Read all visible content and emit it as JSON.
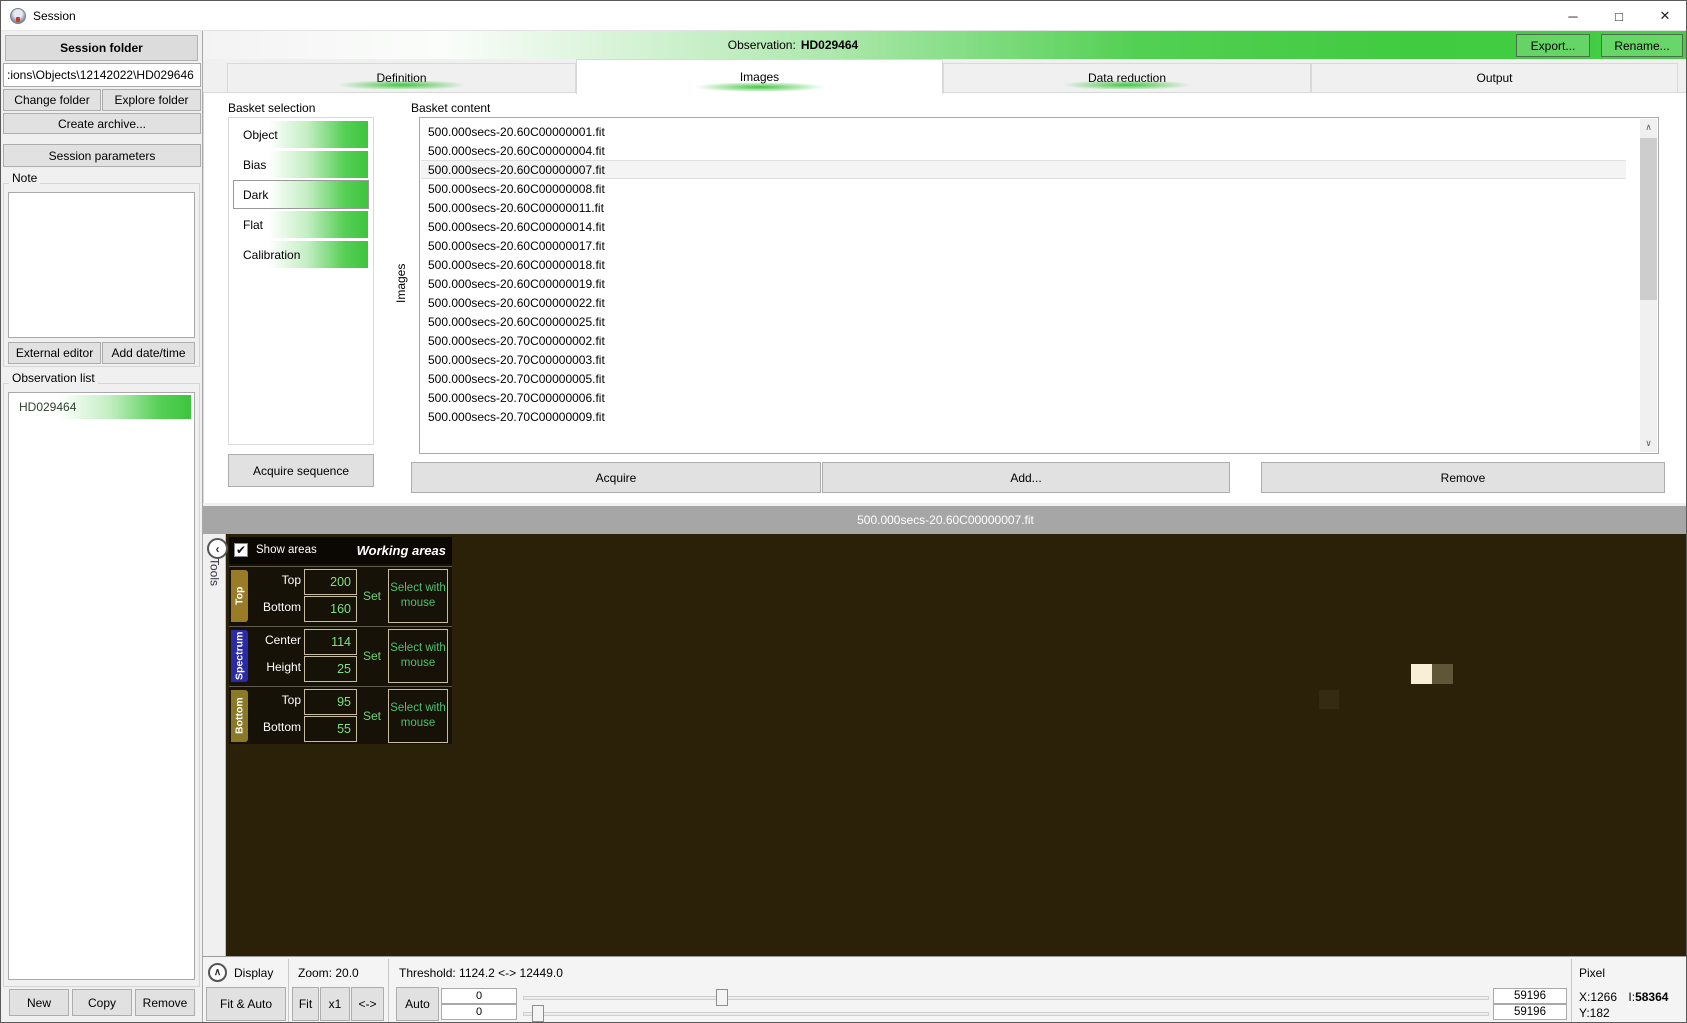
{
  "window": {
    "title": "Session",
    "minimize_glyph": "─",
    "maximize_glyph": "□",
    "close_glyph": "✕"
  },
  "sidebar": {
    "folder_header": "Session folder",
    "path": ":ions\\Objects\\12142022\\HD029646",
    "change_folder": "Change folder",
    "explore_folder": "Explore folder",
    "create_archive": "Create archive...",
    "session_parameters": "Session parameters",
    "note_label": "Note",
    "note_value": "",
    "external_editor": "External editor",
    "add_datetime": "Add date/time",
    "observation_list_label": "Observation list",
    "observations": [
      "HD029464"
    ],
    "new_button": "New",
    "copy_button": "Copy",
    "remove_button": "Remove"
  },
  "header": {
    "observation_label": "Observation:",
    "observation_name": "HD029464",
    "export_button": "Export...",
    "rename_button": "Rename..."
  },
  "tabs": [
    {
      "label": "Definition"
    },
    {
      "label": "Images"
    },
    {
      "label": "Data reduction"
    },
    {
      "label": "Output"
    }
  ],
  "basket": {
    "selection_label": "Basket selection",
    "items": [
      "Object",
      "Bias",
      "Dark",
      "Flat",
      "Calibration"
    ],
    "selected_item": "Dark",
    "acquire_sequence": "Acquire sequence",
    "content_label": "Basket content",
    "images_vertical_label": "Images",
    "files": [
      "500.000secs-20.60C00000001.fit",
      "500.000secs-20.60C00000004.fit",
      "500.000secs-20.60C00000007.fit",
      "500.000secs-20.60C00000008.fit",
      "500.000secs-20.60C00000011.fit",
      "500.000secs-20.60C00000014.fit",
      "500.000secs-20.60C00000017.fit",
      "500.000secs-20.60C00000018.fit",
      "500.000secs-20.60C00000019.fit",
      "500.000secs-20.60C00000022.fit",
      "500.000secs-20.60C00000025.fit",
      "500.000secs-20.70C00000002.fit",
      "500.000secs-20.70C00000003.fit",
      "500.000secs-20.70C00000005.fit",
      "500.000secs-20.70C00000006.fit",
      "500.000secs-20.70C00000009.fit"
    ],
    "selected_file": "500.000secs-20.60C00000007.fit",
    "acquire_button": "Acquire",
    "add_button": "Add...",
    "remove_button": "Remove",
    "scroll_up_glyph": "∧",
    "scroll_down_glyph": "∨"
  },
  "viewer": {
    "title": "500.000secs-20.60C00000007.fit",
    "tools_label": "Tools",
    "collapse_glyph": "‹",
    "show_areas_label": "Show areas",
    "show_areas_checked": "✔",
    "working_areas_title": "Working areas",
    "rows": [
      {
        "tag": "Top",
        "field1": "Top",
        "value1": "200",
        "field2": "Bottom",
        "value2": "160",
        "set_label": "Set",
        "select_label": "Select with mouse"
      },
      {
        "tag": "Spectrum",
        "field1": "Center",
        "value1": "114",
        "field2": "Height",
        "value2": "25",
        "set_label": "Set",
        "select_label": "Select with mouse"
      },
      {
        "tag": "Bottom",
        "field1": "Top",
        "value1": "95",
        "field2": "Bottom",
        "value2": "55",
        "set_label": "Set",
        "select_label": "Select with mouse"
      }
    ]
  },
  "bottom": {
    "display_label": "Display",
    "display_collapse_glyph": "∧",
    "fit_auto_button": "Fit & Auto",
    "zoom_label": "Zoom: 20.0",
    "fit_button": "Fit",
    "x1_button": "x1",
    "stretch_button": "<->",
    "threshold_label": "Threshold: 1124.2 <-> 12449.0",
    "auto_button": "Auto",
    "spin_top": "0",
    "spin_bottom": "0",
    "level_top": "59196",
    "level_bottom": "59196",
    "pixel_label": "Pixel",
    "pixel_x": "X:1266",
    "pixel_i_prefix": "I:",
    "pixel_i_value": "58364",
    "pixel_y": "Y:182"
  },
  "colors": {
    "accent_green": "#3ec43e",
    "viewer_background": "#2a2108",
    "panel_background": "#171208",
    "tag_top": "#9a7b28",
    "tag_spectrum": "#2b2ba8",
    "tag_bottom": "#8a7a28",
    "value_green": "#7fe07f",
    "select_green": "#4fbf6f",
    "bright_pixel": "#f7efd6",
    "olive_pixel": "#5f5638",
    "viewer_titlebar_gray": "#a6a6a6"
  }
}
